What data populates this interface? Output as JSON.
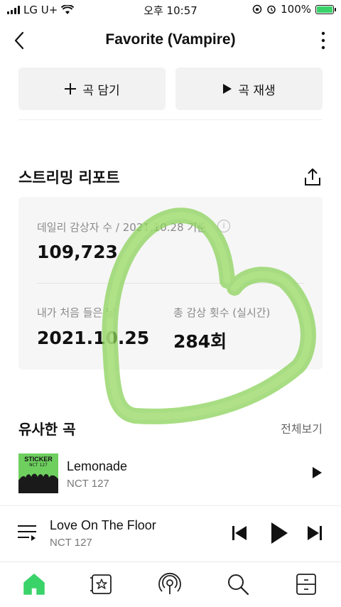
{
  "status_bar": {
    "carrier": "LG U+",
    "time": "오후 10:57",
    "battery": "100%",
    "battery_level": 1.0
  },
  "header": {
    "title": "Favorite (Vampire)",
    "back_icon": "chevron-left-icon",
    "more_icon": "more-vertical-icon"
  },
  "actions": {
    "add_label": "곡 담기",
    "play_label": "곡 재생"
  },
  "report": {
    "title": "스트리밍 리포트",
    "daily_label": "데일리 감상자 수 / 2021.10.28 기준",
    "daily_value": "109,723",
    "info_glyph": "i",
    "first_listen_label": "내가 처음 들은 날",
    "first_listen_value": "2021.10.25",
    "total_label": "총 감상 횟수 (실시간)",
    "total_value": "284회"
  },
  "similar": {
    "title": "유사한 곡",
    "see_all": "전체보기",
    "songs": [
      {
        "title": "Lemonade",
        "artist": "NCT 127",
        "album_text": "STICKER",
        "album_sub": "NCT 127"
      }
    ]
  },
  "now_playing": {
    "title": "Love On The Floor",
    "artist": "NCT 127"
  },
  "bottom_nav": [
    "home-icon",
    "library-icon",
    "podcast-icon",
    "search-icon",
    "drawer-icon"
  ],
  "colors": {
    "accent": "#3ad36a",
    "heart": "#8bd25a"
  }
}
